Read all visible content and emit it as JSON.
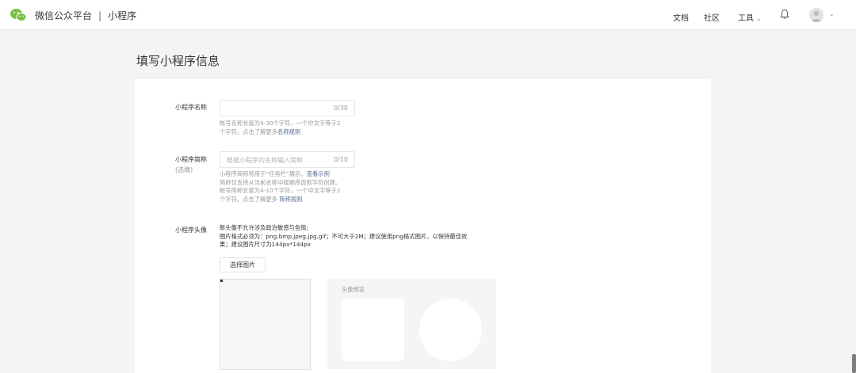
{
  "header": {
    "brand": "微信公众平台",
    "separator": "|",
    "section": "小程序",
    "nav": {
      "docs": "文档",
      "community": "社区",
      "tools": "工具"
    },
    "icons": {
      "logo": "wechat-logo-icon",
      "bell": "bell-icon",
      "avatar": "user-avatar-icon",
      "dropdown": "chevron-down-icon"
    }
  },
  "page": {
    "title": "填写小程序信息"
  },
  "form": {
    "name": {
      "label": "小程序名称",
      "placeholder": "",
      "counter": "0/30",
      "tip_line1": "帐号名称长度为4-30个字符，一个中文字等于2",
      "tip_line2_prefix": "个字符。点击了解更多",
      "tip_link": "名称规则"
    },
    "short_name": {
      "label": "小程序简称",
      "sublabel": "(选填)",
      "placeholder": "根据小程序的名称输入简称",
      "counter": "0/10",
      "tip_line1_prefix": "小程序简称将用于“任务栏”展示。",
      "tip_line1_link": "查看示例",
      "tip_line2": "简称仅支持从当前名称中按顺序选取字符创建。",
      "tip_line3": "帐号简称长度为4-10个字符，一个中文字等于2",
      "tip_line4_prefix": "个字符。点击了解更多 ",
      "tip_line4_link": "简称规则"
    },
    "avatar": {
      "label": "小程序头像",
      "tip_line1": "新头像不允许涉及政治敏感与色情;",
      "tip_line2": "图片格式必须为：png,bmp,jpeg,jpg,gif；不可大于2M；建议使用png格式图片，以保持最佳效",
      "tip_line3": "果；建议图片尺寸为144px*144px",
      "choose_button": "选择图片",
      "preview_title": "头像预览"
    }
  },
  "colors": {
    "background": "#f3f4f6",
    "link": "#576b95",
    "wechat_green": "#7bc043"
  }
}
